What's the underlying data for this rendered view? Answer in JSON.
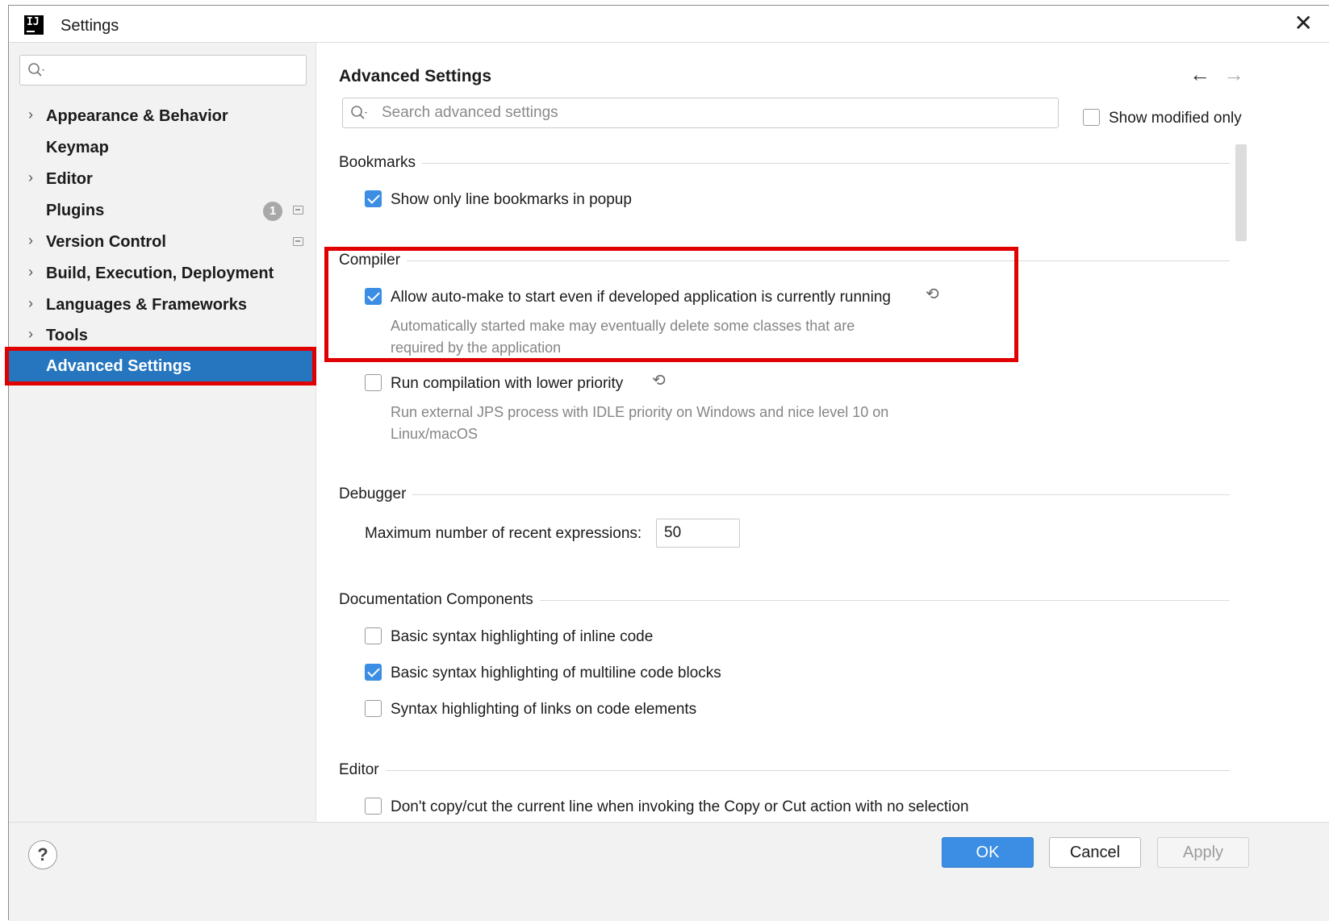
{
  "window": {
    "title": "Settings",
    "logo_text": "IJ",
    "close_glyph": "✕"
  },
  "sidebar": {
    "search_placeholder": "",
    "items": [
      {
        "label": "Appearance & Behavior",
        "expandable": true
      },
      {
        "label": "Keymap",
        "expandable": false
      },
      {
        "label": "Editor",
        "expandable": true
      },
      {
        "label": "Plugins",
        "expandable": false,
        "badge": "1"
      },
      {
        "label": "Version Control",
        "expandable": true
      },
      {
        "label": "Build, Execution, Deployment",
        "expandable": true
      },
      {
        "label": "Languages & Frameworks",
        "expandable": true
      },
      {
        "label": "Tools",
        "expandable": true
      },
      {
        "label": "Advanced Settings",
        "expandable": false,
        "selected": true
      }
    ]
  },
  "main": {
    "title": "Advanced Settings",
    "search_placeholder": "Search advanced settings",
    "show_modified_label": "Show modified only",
    "sections": {
      "bookmarks": {
        "title": "Bookmarks",
        "option_label": "Show only line bookmarks in popup",
        "checked": true
      },
      "compiler": {
        "title": "Compiler",
        "automake_label": "Allow auto-make to start even if developed application is currently running",
        "automake_desc": "Automatically started make may eventually delete some classes that are required by the application",
        "automake_checked": true,
        "lowprio_label": "Run compilation with lower priority",
        "lowprio_desc": "Run external JPS process with IDLE priority on Windows and nice level 10 on Linux/macOS",
        "lowprio_checked": false
      },
      "debugger": {
        "title": "Debugger",
        "max_expr_label": "Maximum number of recent expressions:",
        "max_expr_value": "50"
      },
      "documentation": {
        "title": "Documentation Components",
        "opt1_label": "Basic syntax highlighting of inline code",
        "opt1_checked": false,
        "opt2_label": "Basic syntax highlighting of multiline code blocks",
        "opt2_checked": true,
        "opt3_label": "Syntax highlighting of links on code elements",
        "opt3_checked": false
      },
      "editor": {
        "title": "Editor",
        "opt1_label": "Don't copy/cut the current line when invoking the Copy or Cut action with no selection"
      }
    }
  },
  "footer": {
    "help_label": "?",
    "ok_label": "OK",
    "cancel_label": "Cancel",
    "apply_label": "Apply"
  },
  "icons": {
    "search": "search-icon",
    "chevron": "chevron-right-icon",
    "back": "arrow-left-icon",
    "forward": "arrow-right-icon",
    "reset": "reset-icon",
    "project": "project-level-icon"
  },
  "colors": {
    "accent": "#2675bf",
    "checkbox_on": "#3b8ee3",
    "highlight": "#e00000"
  }
}
